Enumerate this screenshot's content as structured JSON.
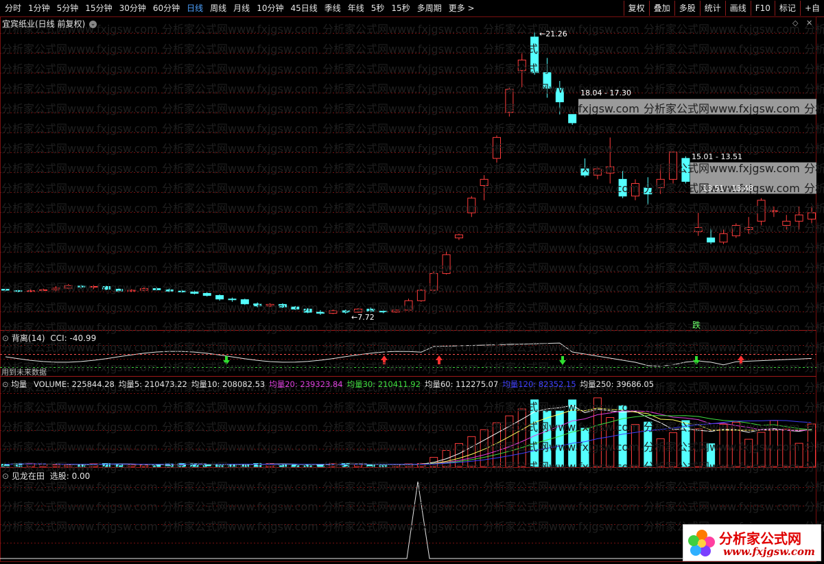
{
  "toolbar": {
    "periods": [
      "分时",
      "1分钟",
      "5分钟",
      "15分钟",
      "30分钟",
      "60分钟",
      "日线",
      "周线",
      "月线",
      "10分钟",
      "45日线",
      "季线",
      "年线",
      "5秒",
      "15秒",
      "多周期",
      "更多 >"
    ],
    "active_period": "日线",
    "buttons": [
      "复权",
      "叠加",
      "多股",
      "统计",
      "画线",
      "F10",
      "标记",
      "+自"
    ]
  },
  "main_panel": {
    "title": "宜宾纸业(日线 前复权)",
    "high_label": "21.26",
    "low_label": "7.72",
    "zone1_label": "18.04 - 17.30",
    "zone2_label": "15.01 - 13.51",
    "zone3_label": "13.51 - 13.48",
    "signal_label": "跌"
  },
  "cci_panel": {
    "name": "背离(14)",
    "value_label": "CCI: -40.99",
    "note": "用到未来数据"
  },
  "volume_panel": {
    "name": "均量",
    "items": [
      {
        "label": "VOLUME: 225844.28",
        "color": "#e6e6e6"
      },
      {
        "label": "均量5: 210473.22",
        "color": "#e6e6e6"
      },
      {
        "label": "均量10: 208082.53",
        "color": "#e6e6e6"
      },
      {
        "label": "均量20: 239323.84",
        "color": "#e040e0"
      },
      {
        "label": "均量30: 210411.92",
        "color": "#40e040"
      },
      {
        "label": "均量60: 112275.07",
        "color": "#e6e6e6"
      },
      {
        "label": "均量120: 82352.15",
        "color": "#4040ff"
      },
      {
        "label": "均量250: 39686.05",
        "color": "#e6e6e6"
      }
    ]
  },
  "bottom_panel": {
    "name": "见龙在田",
    "value_label": "选股: 0.00"
  },
  "watermark": {
    "text": "分析家公式网www.fxjgsw.com"
  },
  "logo": {
    "text": "分析家公式网",
    "url": "www.fxjgsw.com"
  },
  "colors": {
    "up": "#ff3c3c",
    "down": "#54ffff",
    "grid": "#7a1010",
    "active": "#4ea2ff"
  },
  "chart_data": {
    "type": "candlestick",
    "price_axis": {
      "min": 7.72,
      "max": 21.26
    },
    "candles_ohlc": [
      [
        8.95,
        8.98,
        8.85,
        8.9
      ],
      [
        8.88,
        8.93,
        8.8,
        8.85
      ],
      [
        8.86,
        8.95,
        8.8,
        8.88
      ],
      [
        8.9,
        8.98,
        8.85,
        8.92
      ],
      [
        8.92,
        9.1,
        8.85,
        9.0
      ],
      [
        9.0,
        9.2,
        8.95,
        9.12
      ],
      [
        9.1,
        9.15,
        8.98,
        9.05
      ],
      [
        9.05,
        9.15,
        8.95,
        9.08
      ],
      [
        9.08,
        9.12,
        8.9,
        8.95
      ],
      [
        8.95,
        9.02,
        8.8,
        8.86
      ],
      [
        8.86,
        8.95,
        8.82,
        8.9
      ],
      [
        8.9,
        9.05,
        8.85,
        8.98
      ],
      [
        8.98,
        9.05,
        8.88,
        8.92
      ],
      [
        8.92,
        8.98,
        8.82,
        8.86
      ],
      [
        8.86,
        8.92,
        8.78,
        8.82
      ],
      [
        8.82,
        8.88,
        8.7,
        8.75
      ],
      [
        8.75,
        8.8,
        8.6,
        8.65
      ],
      [
        8.65,
        8.7,
        8.4,
        8.48
      ],
      [
        8.48,
        8.55,
        8.35,
        8.45
      ],
      [
        8.45,
        8.5,
        8.2,
        8.25
      ],
      [
        8.25,
        8.32,
        8.08,
        8.15
      ],
      [
        8.15,
        8.28,
        8.1,
        8.22
      ],
      [
        8.22,
        8.28,
        8.05,
        8.1
      ],
      [
        8.1,
        8.15,
        7.95,
        8.0
      ],
      [
        8.0,
        8.05,
        7.8,
        7.85
      ],
      [
        7.85,
        7.95,
        7.72,
        7.8
      ],
      [
        7.8,
        7.98,
        7.76,
        7.92
      ],
      [
        7.92,
        7.98,
        7.78,
        7.85
      ],
      [
        7.85,
        8.05,
        7.82,
        8.0
      ],
      [
        8.0,
        8.1,
        7.85,
        7.9
      ],
      [
        7.9,
        7.98,
        7.8,
        7.86
      ],
      [
        7.86,
        7.98,
        7.82,
        7.95
      ],
      [
        7.95,
        8.5,
        7.9,
        8.4
      ],
      [
        8.4,
        8.95,
        8.35,
        8.9
      ],
      [
        8.9,
        9.8,
        8.85,
        9.7
      ],
      [
        9.7,
        10.8,
        9.65,
        10.6
      ],
      [
        11.4,
        11.6,
        11.3,
        11.55
      ],
      [
        12.6,
        13.4,
        12.4,
        13.3
      ],
      [
        13.9,
        14.4,
        13.2,
        14.2
      ],
      [
        15.2,
        16.3,
        15.0,
        16.2
      ],
      [
        17.4,
        18.6,
        17.2,
        18.5
      ],
      [
        19.4,
        20.2,
        18.6,
        19.9
      ],
      [
        21.0,
        21.26,
        19.2,
        19.3
      ],
      [
        19.3,
        20.0,
        18.1,
        18.55
      ],
      [
        18.55,
        18.9,
        17.3,
        17.9
      ],
      [
        17.3,
        17.3,
        16.8,
        16.9
      ],
      [
        14.7,
        15.2,
        14.3,
        14.4
      ],
      [
        14.4,
        14.8,
        14.2,
        14.7
      ],
      [
        14.5,
        16.2,
        14.0,
        14.8
      ],
      [
        14.2,
        14.6,
        13.3,
        13.4
      ],
      [
        13.4,
        14.2,
        13.2,
        14.0
      ],
      [
        13.8,
        14.3,
        13.0,
        13.5
      ],
      [
        13.8,
        14.9,
        13.5,
        14.2
      ],
      [
        14.2,
        15.5,
        14.0,
        15.5
      ],
      [
        15.2,
        15.3,
        14.0,
        14.1
      ],
      [
        11.7,
        12.6,
        11.5,
        11.9
      ],
      [
        11.4,
        11.9,
        11.1,
        11.2
      ],
      [
        11.2,
        11.8,
        11.1,
        11.6
      ],
      [
        11.5,
        12.1,
        11.4,
        12.0
      ],
      [
        11.8,
        12.4,
        11.6,
        11.9
      ],
      [
        12.2,
        13.3,
        12.0,
        13.2
      ],
      [
        12.7,
        12.9,
        12.4,
        12.7
      ],
      [
        12.0,
        12.5,
        11.8,
        12.2
      ],
      [
        12.2,
        12.9,
        11.8,
        12.5
      ],
      [
        12.3,
        12.9,
        12.1,
        12.6
      ]
    ]
  }
}
